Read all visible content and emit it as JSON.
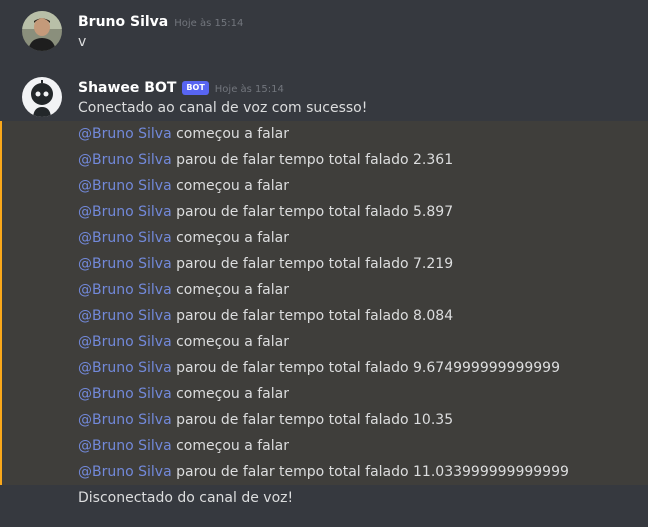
{
  "messages": [
    {
      "author": "Bruno Silva",
      "timestamp": "Hoje às 15:14",
      "lines": [
        "v"
      ]
    },
    {
      "author": "Shawee BOT",
      "bot_tag": "BOT",
      "timestamp": "Hoje às 15:14",
      "first_line": "Conectado ao canal de voz com sucesso!",
      "mention": "@Bruno Silva",
      "log_lines": [
        " começou a falar",
        " parou de falar tempo total falado 2.361",
        " começou a falar",
        " parou de falar tempo total falado 5.897",
        " começou a falar",
        " parou de falar tempo total falado 7.219",
        " começou a falar",
        " parou de falar tempo total falado 8.084",
        " começou a falar",
        " parou de falar tempo total falado 9.674999999999999",
        " começou a falar",
        " parou de falar tempo total falado 10.35",
        " começou a falar",
        " parou de falar tempo total falado 11.033999999999999"
      ],
      "last_line": "Disconectado do canal de voz!"
    }
  ],
  "colors": {
    "background": "#36393f",
    "highlight": "#3f3e3b",
    "highlight_border": "#faa81a",
    "mention": "#7289da",
    "bot_tag": "#5865f2"
  }
}
